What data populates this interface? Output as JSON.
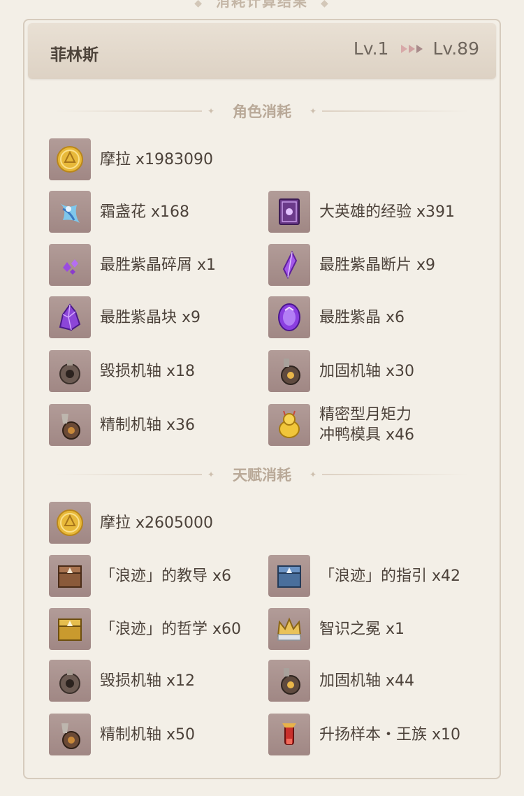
{
  "page_title": "消耗计算结果",
  "character": {
    "name": "菲林斯",
    "level_from": "Lv.1",
    "level_to": "Lv.89"
  },
  "sections": {
    "character_cost": {
      "title": "角色消耗",
      "items": [
        {
          "name": "摩拉 x1983090",
          "icon": "mora-coin-icon"
        },
        {
          "name": "霜盏花 x168",
          "icon": "frost-lamp-flower-icon"
        },
        {
          "name": "大英雄的经验 x391",
          "icon": "heros-wit-book-icon"
        },
        {
          "name": "最胜紫晶碎屑 x1",
          "icon": "amethyst-sliver-icon"
        },
        {
          "name": "最胜紫晶断片 x9",
          "icon": "amethyst-fragment-icon"
        },
        {
          "name": "最胜紫晶块 x9",
          "icon": "amethyst-chunk-icon"
        },
        {
          "name": "最胜紫晶 x6",
          "icon": "amethyst-gemstone-icon"
        },
        {
          "name": "毁损机轴 x18",
          "icon": "damaged-axis-icon"
        },
        {
          "name": "加固机轴 x30",
          "icon": "reinforced-axis-icon"
        },
        {
          "name": "精制机轴 x36",
          "icon": "refined-axis-icon"
        },
        {
          "name_line1": "精密型月矩力",
          "name_line2": "冲鸭模具 x46",
          "icon": "moonwheel-mold-icon"
        }
      ]
    },
    "talent_cost": {
      "title": "天赋消耗",
      "items": [
        {
          "name": "摩拉 x2605000",
          "icon": "mora-coin-icon"
        },
        {
          "name": "「浪迹」的教导 x6",
          "icon": "teachings-book-icon"
        },
        {
          "name": "「浪迹」的指引 x42",
          "icon": "guide-book-icon"
        },
        {
          "name": "「浪迹」的哲学 x60",
          "icon": "philosophies-book-icon"
        },
        {
          "name": "智识之冕 x1",
          "icon": "crown-of-insight-icon"
        },
        {
          "name": "毁损机轴 x12",
          "icon": "damaged-axis-icon"
        },
        {
          "name": "加固机轴 x44",
          "icon": "reinforced-axis-icon"
        },
        {
          "name": "精制机轴 x50",
          "icon": "refined-axis-icon"
        },
        {
          "name": "升扬样本・王族 x10",
          "icon": "ascension-sample-royal-icon"
        }
      ]
    }
  }
}
